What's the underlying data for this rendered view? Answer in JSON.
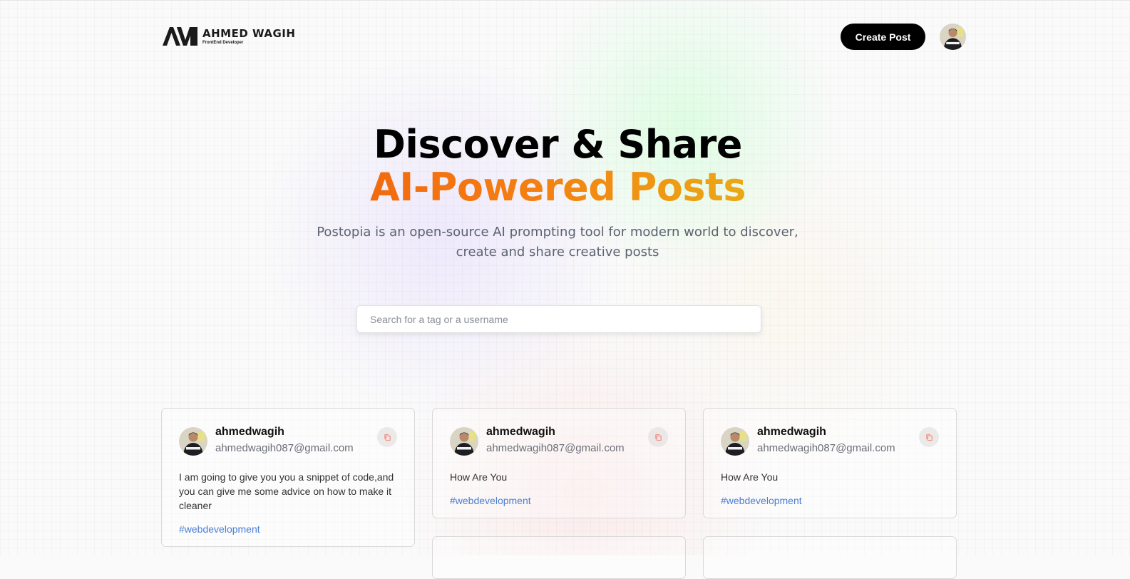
{
  "nav": {
    "logo_name": "AHMED WAGIH",
    "logo_subtitle": "FrontEnd Developer",
    "create_post_label": "Create Post"
  },
  "hero": {
    "title_line1": "Discover & Share",
    "title_line2": "AI-Powered Posts",
    "description": "Postopia is an open-source AI prompting tool for modern world to discover, create and share creative posts"
  },
  "search": {
    "placeholder": "Search for a tag or a username",
    "value": ""
  },
  "posts": [
    {
      "username": "ahmedwagih",
      "email": "ahmedwagih087@gmail.com",
      "text": "I am going to give you you a snippet of code,and you can give me some advice on how to make it cleaner",
      "tag": "#webdevelopment"
    },
    {
      "username": "ahmedwagih",
      "email": "ahmedwagih087@gmail.com",
      "text": "How Are You",
      "tag": "#webdevelopment"
    },
    {
      "username": "ahmedwagih",
      "email": "ahmedwagih087@gmail.com",
      "text": "How Are You",
      "tag": "#webdevelopment"
    }
  ],
  "colors": {
    "accent_start": "#f26a10",
    "accent_end": "#eaa916",
    "tag": "#4a7fd6",
    "button": "#000000"
  },
  "icons": [
    "logo-icon",
    "avatar",
    "copy-icon"
  ]
}
